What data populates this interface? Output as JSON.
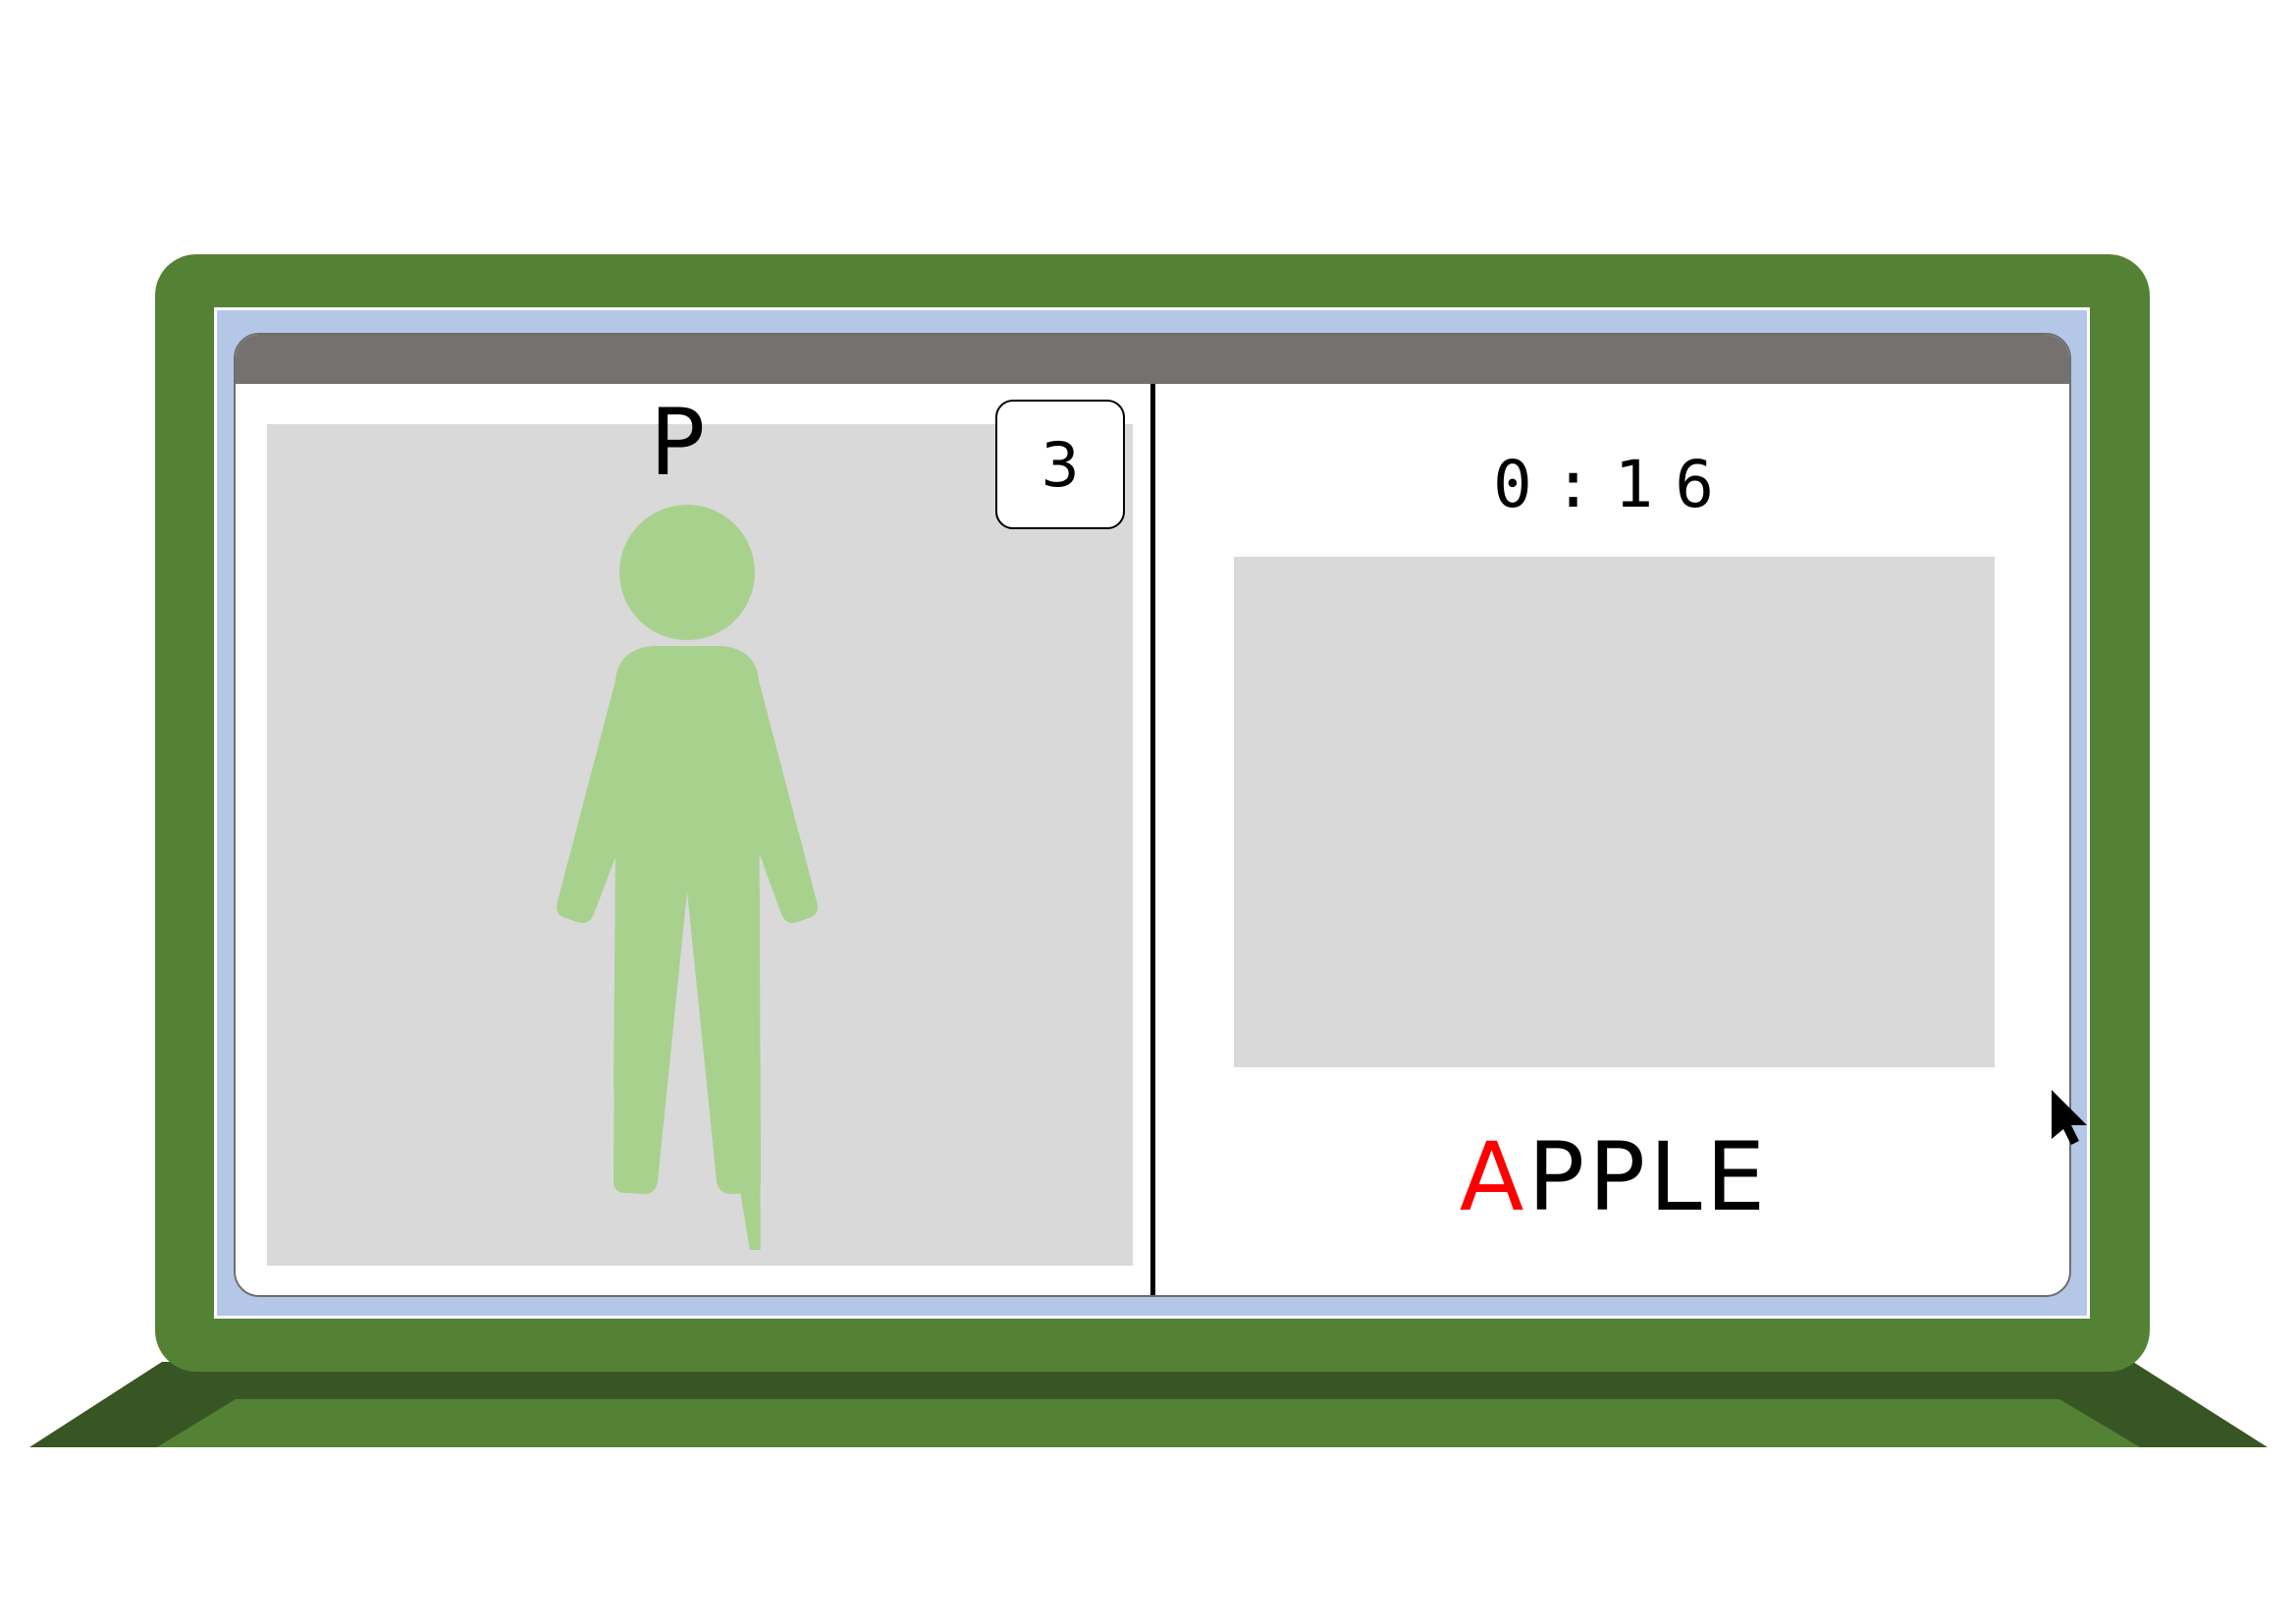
{
  "colors": {
    "laptop_green": "#548235",
    "laptop_dark_green": "#375623",
    "screen_blue": "#b4c7e7",
    "title_bar": "#767171",
    "placeholder_gray": "#d9d9d9",
    "figure_green": "#a9d18e",
    "highlight_red": "#ff0000"
  },
  "left_pane": {
    "person_letter": "P",
    "count_badge": "3",
    "figure_icon": "person-icon"
  },
  "right_pane": {
    "timer": "0:16",
    "word": {
      "highlight": "A",
      "rest": "PPLE"
    }
  },
  "cursor_icon": "mouse-pointer-icon"
}
